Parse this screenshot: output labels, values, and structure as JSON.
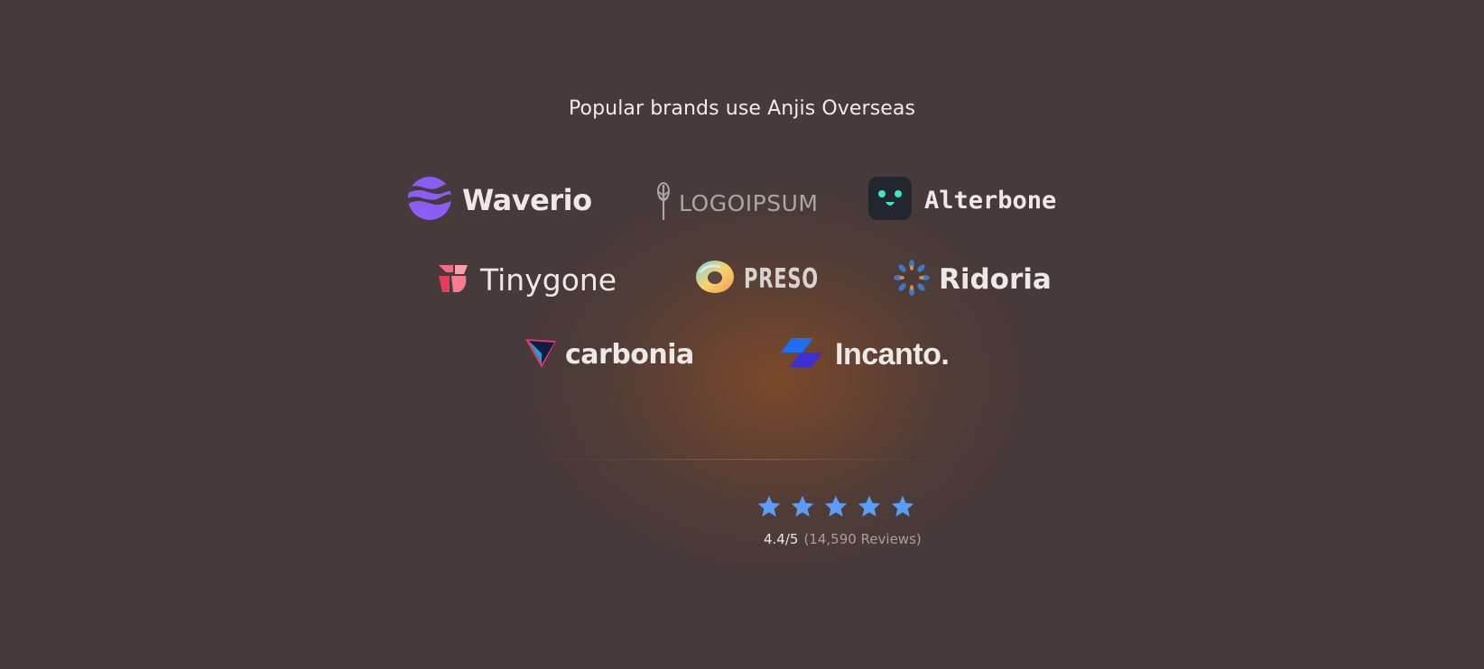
{
  "headline": "Popular brands use Anjis Overseas",
  "brands": [
    {
      "name": "Waverio",
      "icon": "waves-circle-icon"
    },
    {
      "name": "LOGOIPSUM",
      "icon": "wheat-icon"
    },
    {
      "name": "Alterbone",
      "icon": "smiley-face-icon"
    },
    {
      "name": "Tinygone",
      "icon": "pink-shapes-icon"
    },
    {
      "name": "PRESO",
      "icon": "rainbow-ring-icon"
    },
    {
      "name": "Ridoria",
      "icon": "sunburst-icon"
    },
    {
      "name": "carbonia",
      "icon": "triangle-gem-icon"
    },
    {
      "name": "Incanto.",
      "icon": "parallelogram-icon"
    }
  ],
  "rating": {
    "stars": 5,
    "score": "4.4/5",
    "reviews": "(14,590 Reviews)",
    "star_color": "#5b9df5"
  },
  "colors": {
    "background": "#463a3a",
    "glow": "#a6541e",
    "text": "#ece9e6"
  }
}
